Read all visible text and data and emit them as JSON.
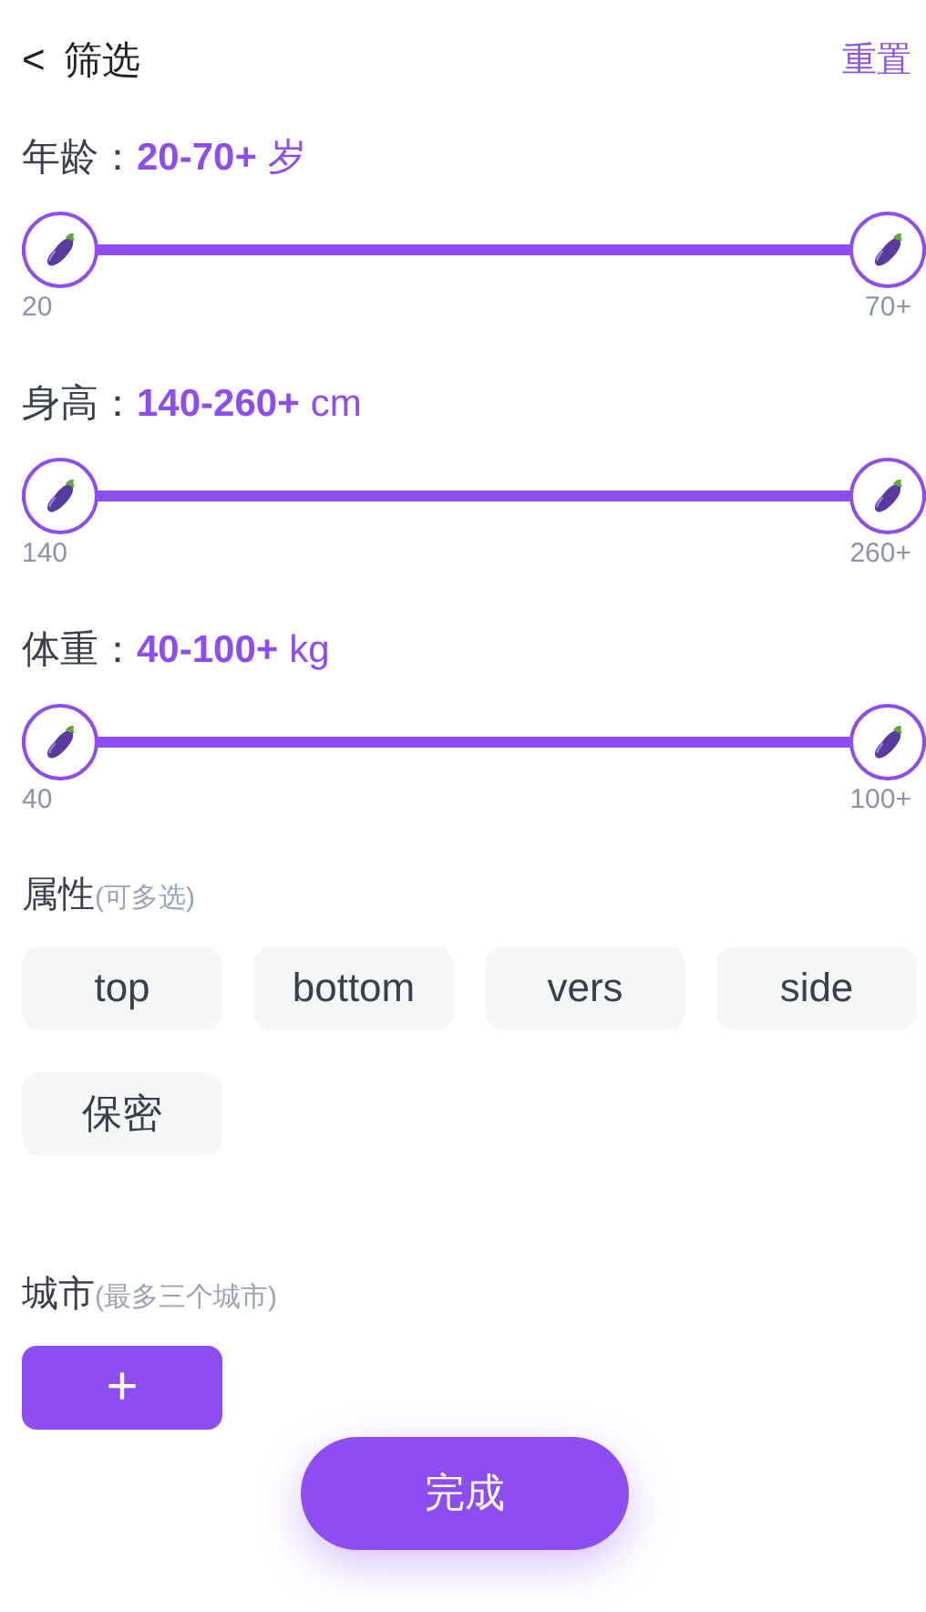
{
  "header": {
    "back": "<",
    "title": "筛选",
    "reset": "重置"
  },
  "ranges": [
    {
      "label": "年龄：",
      "value": "20-70+",
      "unit": "岁",
      "min_label": "20",
      "max_label": "70+",
      "thumbs": [
        {
          "level": 0
        },
        {
          "level": 1
        }
      ]
    },
    {
      "label": "身高：",
      "value": "140-260+",
      "unit": "cm",
      "min_label": "140",
      "max_label": "260+",
      "thumbs": [
        {
          "level": 0
        },
        {
          "level": 1
        }
      ]
    },
    {
      "label": "体重：",
      "value": "40-100+",
      "unit": "kg",
      "min_label": "40",
      "max_label": "100+",
      "thumbs": [
        {
          "level": 0
        },
        {
          "level": 1
        }
      ]
    }
  ],
  "attributes": {
    "title": "属性",
    "hint": "(可多选)",
    "options": [
      {
        "label": "top",
        "selected": false
      },
      {
        "label": "bottom",
        "selected": false
      },
      {
        "label": "vers",
        "selected": false
      },
      {
        "label": "side",
        "selected": false
      },
      {
        "label": "保密",
        "selected": false
      }
    ]
  },
  "city": {
    "title": "城市",
    "hint": "(最多三个城市)",
    "add": "+"
  },
  "done": "完成"
}
